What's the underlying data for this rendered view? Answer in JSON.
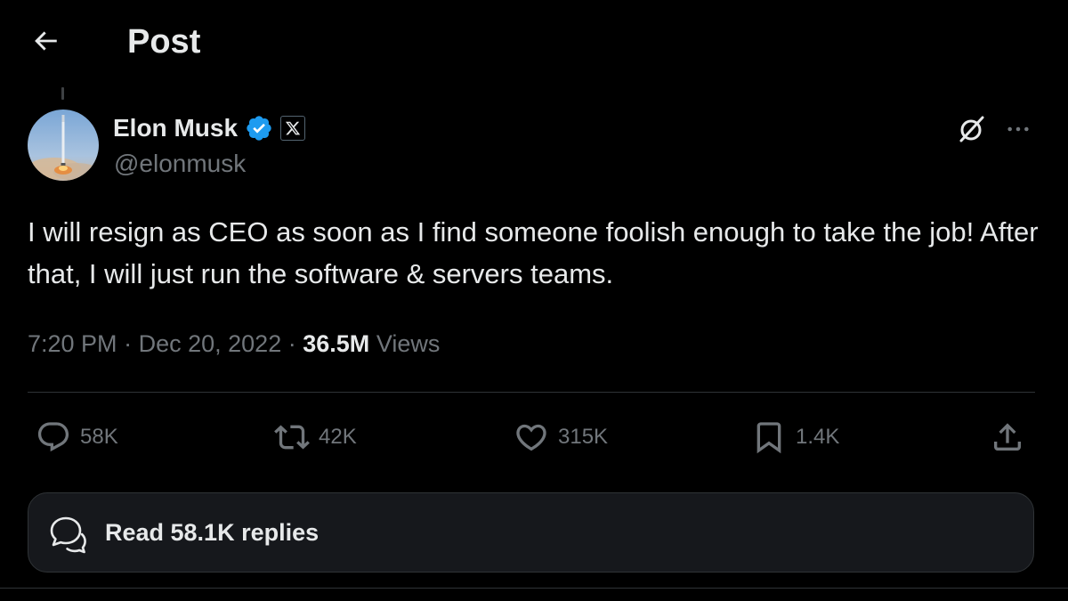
{
  "header": {
    "title": "Post"
  },
  "author": {
    "display_name": "Elon Musk",
    "handle": "@elonmusk",
    "verified_color": "#1d9bf0",
    "badge_icon": "x-logo-icon"
  },
  "tweet": {
    "text": "I will resign as CEO as soon as I find someone foolish enough to take the job! After that, I will just run the software & servers teams.",
    "time": "7:20 PM",
    "separator": "·",
    "date": "Dec 20, 2022",
    "views_count": "36.5M",
    "views_label": "Views"
  },
  "actions": {
    "replies": "58K",
    "reposts": "42K",
    "likes": "315K",
    "bookmarks": "1.4K"
  },
  "read_replies": {
    "label": "Read 58.1K replies"
  },
  "colors": {
    "background": "#000000",
    "text_primary": "#e7e9ea",
    "text_secondary": "#71767b",
    "border": "#2f3336",
    "accent": "#1d9bf0"
  }
}
